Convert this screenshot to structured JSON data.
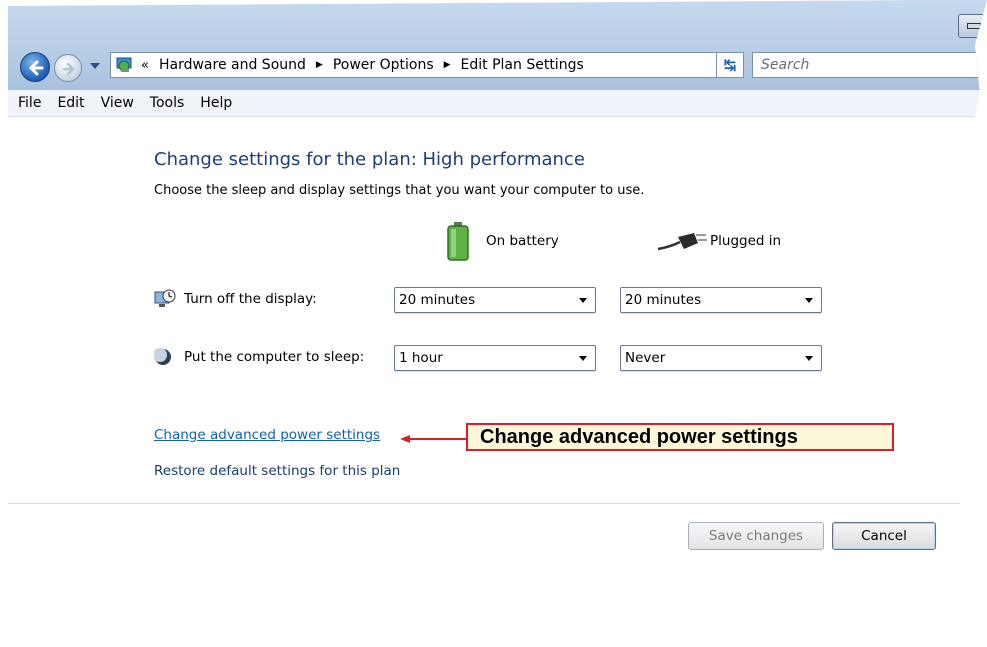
{
  "toolbar": {
    "address_crumbs": [
      "Hardware and Sound",
      "Power Options",
      "Edit Plan Settings"
    ],
    "address_prefix": "«",
    "search_placeholder": "Search"
  },
  "menu": [
    "File",
    "Edit",
    "View",
    "Tools",
    "Help"
  ],
  "main": {
    "title": "Change settings for the plan: High performance",
    "description": "Choose the sleep and display settings that you want your computer to use.",
    "columns": {
      "battery": "On battery",
      "plugged": "Plugged in"
    },
    "rows": [
      {
        "label": "Turn off the display:",
        "battery": "20 minutes",
        "plugged": "20 minutes"
      },
      {
        "label": "Put the computer to sleep:",
        "battery": "1 hour",
        "plugged": "Never"
      }
    ],
    "links": {
      "advanced": "Change advanced power settings",
      "restore": "Restore default settings for this plan"
    },
    "callout": "Change advanced power settings",
    "buttons": {
      "save": "Save changes",
      "cancel": "Cancel"
    }
  },
  "colors": {
    "accent": "#d8202a",
    "link": "#0d62b7",
    "title": "#1e3f78"
  }
}
